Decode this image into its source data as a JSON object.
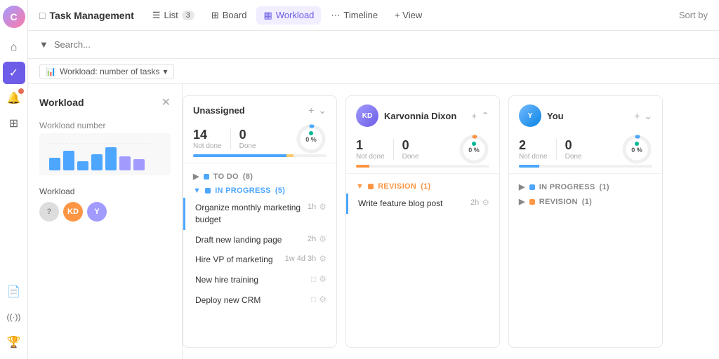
{
  "app": {
    "logo": "C",
    "title": "Task Management",
    "sort_by": "Sort by"
  },
  "nav": {
    "items": [
      {
        "id": "list",
        "label": "List",
        "badge": "3",
        "icon": "☰",
        "active": false
      },
      {
        "id": "board",
        "label": "Board",
        "icon": "⊞",
        "active": false
      },
      {
        "id": "workload",
        "label": "Workload",
        "icon": "▦",
        "active": true
      },
      {
        "id": "timeline",
        "label": "Timeline",
        "icon": "⋯",
        "active": false
      }
    ],
    "view_label": "+ View"
  },
  "toolbar": {
    "search_placeholder": "Search...",
    "metric_label": "Workload: number of tasks",
    "metric_icon": "📊"
  },
  "workload_panel": {
    "title": "Workload",
    "number_label": "Workload number",
    "avatars": [
      "?",
      "KD",
      "Y"
    ]
  },
  "columns": [
    {
      "id": "unassigned",
      "title": "Unassigned",
      "avatar": null,
      "not_done": "14",
      "done": "0",
      "percent": "0 %",
      "not_done_label": "Not done",
      "done_label": "Done",
      "progress_segments": [
        {
          "pct": 70,
          "color": "bar-blue"
        },
        {
          "pct": 5,
          "color": "bar-yellow"
        }
      ],
      "sections": [
        {
          "id": "todo",
          "label": "TO DO",
          "count": "8",
          "color": "blue",
          "collapsed": true,
          "tasks": []
        },
        {
          "id": "in_progress",
          "label": "IN PROGRESS",
          "count": "5",
          "color": "blue",
          "collapsed": false,
          "tasks": [
            {
              "name": "Organize monthly marketing budget",
              "time": "1h",
              "highlight": true
            },
            {
              "name": "Draft new landing page",
              "time": "2h",
              "highlight": false
            },
            {
              "name": "Hire VP of marketing",
              "time": "1w 4d 3h",
              "highlight": false
            },
            {
              "name": "New hire training",
              "time": "",
              "highlight": false
            },
            {
              "name": "Deploy new CRM",
              "time": "",
              "highlight": false
            }
          ]
        }
      ]
    },
    {
      "id": "karvonnia",
      "title": "Karvonnia Dixon",
      "avatar": "KD",
      "avatar_type": "purple-grad",
      "not_done": "1",
      "done": "0",
      "percent": "0 %",
      "not_done_label": "Not done",
      "done_label": "Done",
      "progress_segments": [
        {
          "pct": 10,
          "color": "bar-orange"
        }
      ],
      "sections": [
        {
          "id": "revision",
          "label": "REVISION",
          "count": "1",
          "color": "orange",
          "collapsed": false,
          "tasks": [
            {
              "name": "Write feature blog post",
              "time": "2h",
              "highlight": true
            }
          ]
        }
      ]
    },
    {
      "id": "you",
      "title": "You",
      "avatar": "Y",
      "avatar_type": "blue-grad",
      "not_done": "2",
      "done": "0",
      "percent": "0 %",
      "not_done_label": "Not done",
      "done_label": "Done",
      "progress_segments": [
        {
          "pct": 15,
          "color": "bar-blue"
        }
      ],
      "sections": [
        {
          "id": "in_progress_you",
          "label": "IN PROGRESS",
          "count": "1",
          "color": "blue",
          "collapsed": true,
          "tasks": []
        },
        {
          "id": "revision_you",
          "label": "REVISION",
          "count": "1",
          "color": "orange",
          "collapsed": true,
          "tasks": []
        }
      ]
    }
  ],
  "sidebar_icons": [
    {
      "id": "home",
      "icon": "⌂",
      "active": false
    },
    {
      "id": "check",
      "icon": "✓",
      "active": true
    },
    {
      "id": "bell",
      "icon": "🔔",
      "active": false
    },
    {
      "id": "apps",
      "icon": "⊞",
      "active": false
    },
    {
      "id": "doc",
      "icon": "📄",
      "active": false
    },
    {
      "id": "radio",
      "icon": "⊙",
      "active": false
    },
    {
      "id": "trophy",
      "icon": "🏆",
      "active": false
    }
  ]
}
